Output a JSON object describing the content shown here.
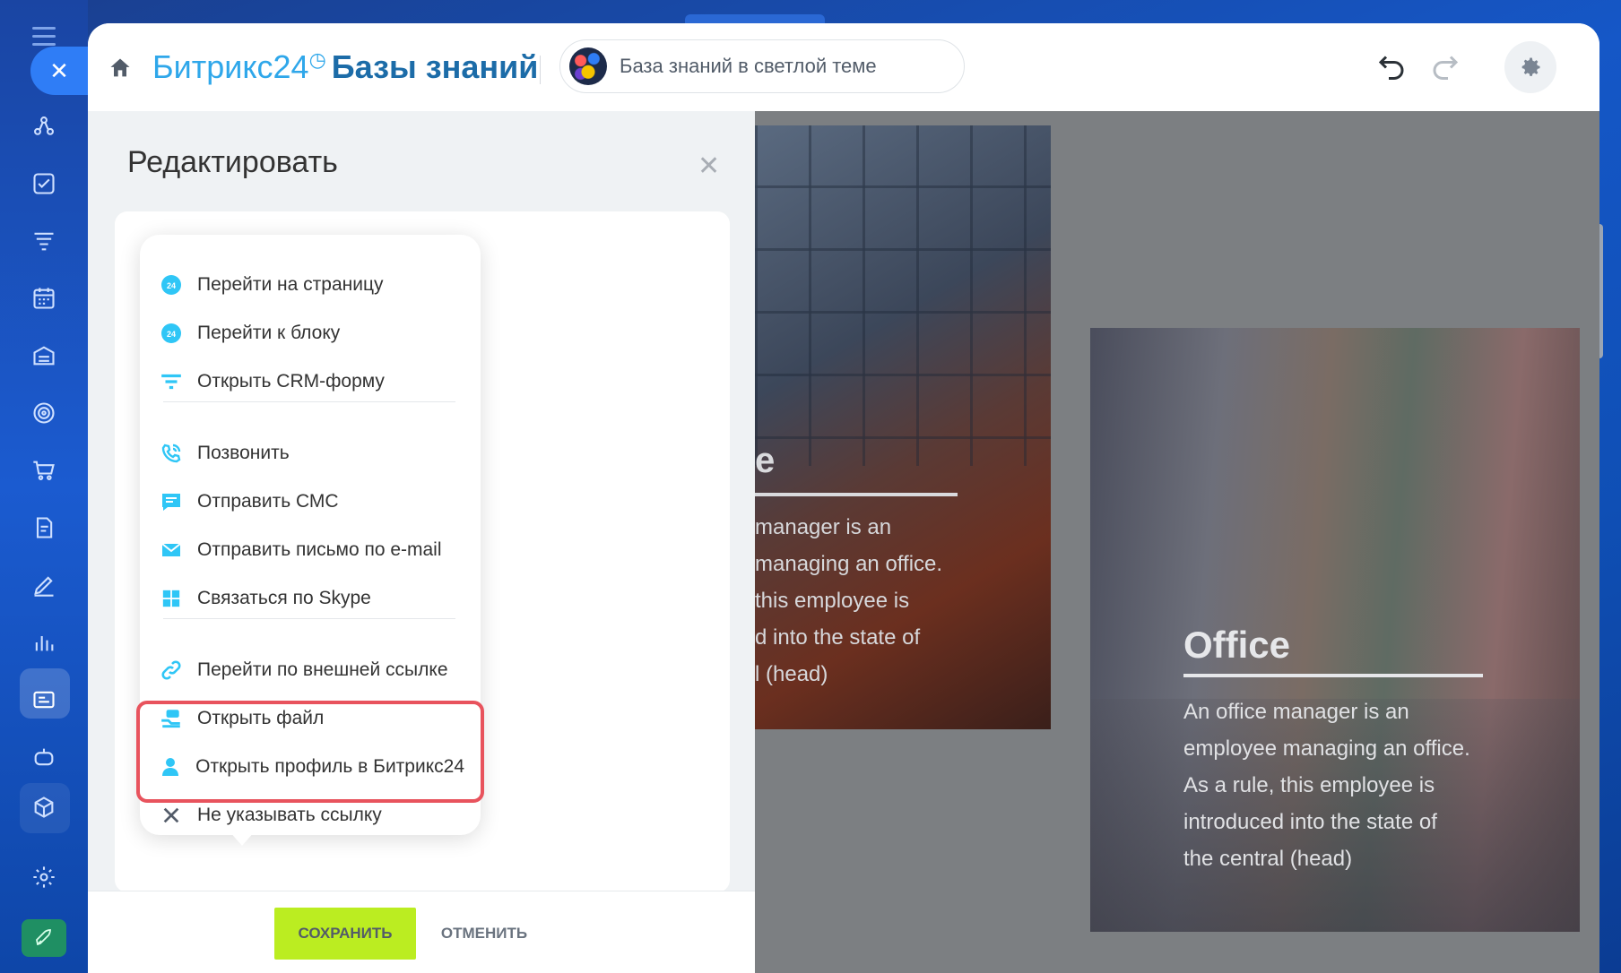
{
  "header": {
    "brand_bitrix": "Битрикс24",
    "brand_kb": "Базы знаний",
    "kb_selector_label": "База знаний в светлой теме"
  },
  "edit_panel": {
    "title": "Редактировать",
    "save_label": "СОХРАНИТЬ",
    "cancel_label": "ОТМЕНИТЬ"
  },
  "link_menu": {
    "items": [
      {
        "label": "Перейти на страницу",
        "icon": "bitrix24-icon"
      },
      {
        "label": "Перейти к блоку",
        "icon": "bitrix24-icon"
      },
      {
        "label": "Открыть CRM-форму",
        "icon": "crm-form-icon"
      },
      {
        "label": "Позвонить",
        "icon": "phone-icon"
      },
      {
        "label": "Отправить СМС",
        "icon": "sms-icon"
      },
      {
        "label": "Отправить письмо по e-mail",
        "icon": "email-icon"
      },
      {
        "label": "Связаться по Skype",
        "icon": "skype-icon"
      },
      {
        "label": "Перейти по внешней ссылке",
        "icon": "link-icon"
      },
      {
        "label": "Открыть файл",
        "icon": "file-icon"
      },
      {
        "label": "Открыть профиль в Битрикс24",
        "icon": "user-icon"
      },
      {
        "label": "Не указывать ссылку",
        "icon": "cross-icon"
      }
    ],
    "highlighted_items": [
      "Открыть файл",
      "Открыть профиль в Битрикс24"
    ]
  },
  "preview": {
    "card1": {
      "title_fragment": "e",
      "lines": [
        "manager is an",
        "managing an office.",
        "this employee is",
        "d into the state of",
        "l (head)"
      ]
    },
    "card2": {
      "title": "Office",
      "lines": [
        "An office manager is an",
        "employee managing an office.",
        "As a rule, this employee is",
        "introduced into the state of",
        "the central (head)"
      ]
    }
  },
  "colors": {
    "accent_blue": "#2fa7ea",
    "kb_title": "#1c6ca8",
    "save_button": "#bbed21",
    "highlight_border": "#e8535d",
    "menu_icon": "#2fc6f6"
  }
}
